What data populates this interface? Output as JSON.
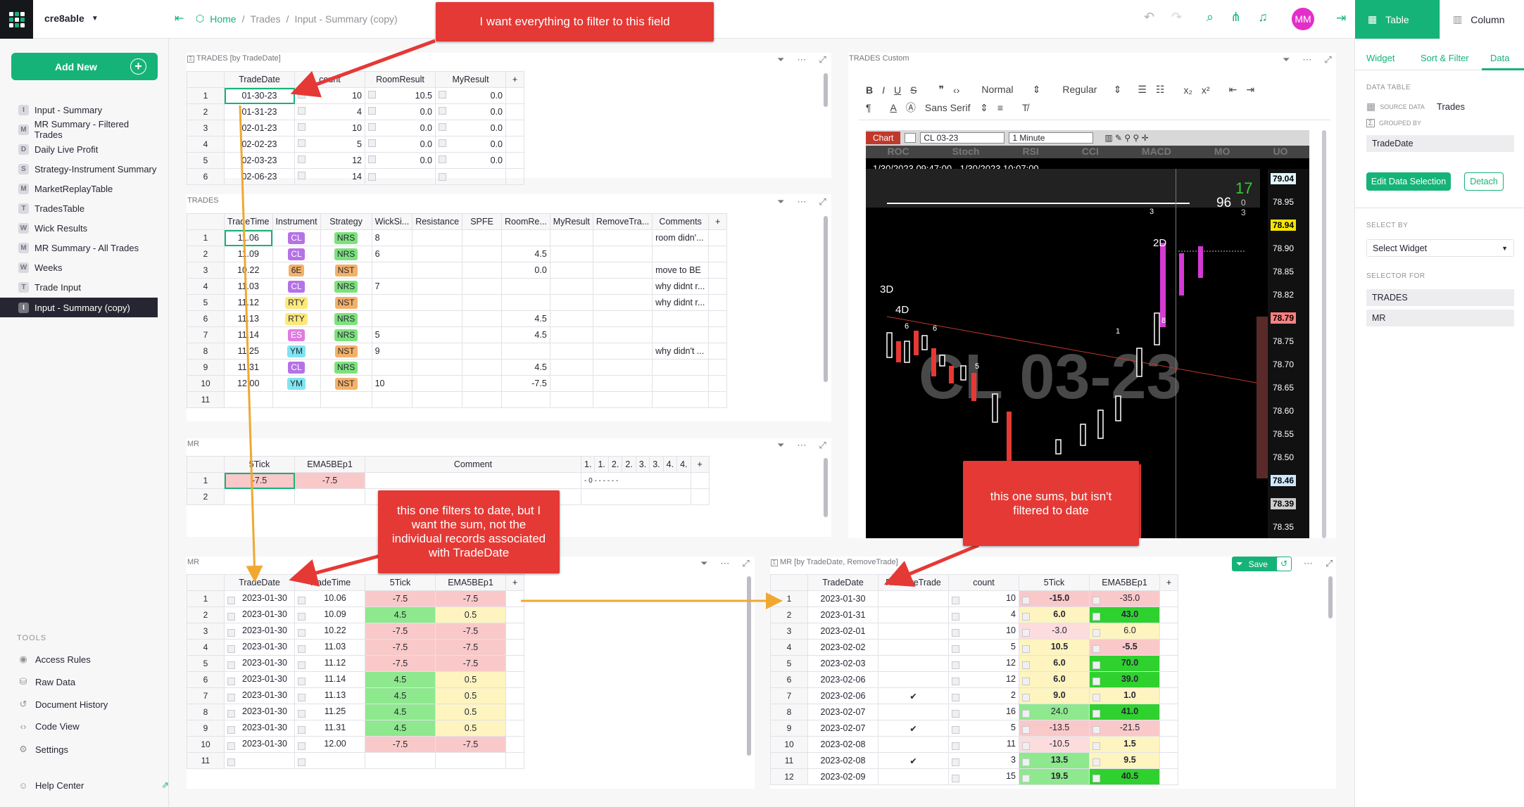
{
  "app": {
    "org": "cre8able"
  },
  "breadcrumb": [
    "Home",
    "Trades",
    "Input - Summary (copy)"
  ],
  "user": {
    "initials": "MM",
    "avatar_color": "#e32fc9"
  },
  "top_tabs": {
    "table": "Table",
    "column": "Column"
  },
  "sidebar": {
    "add_new": "Add New",
    "pages": [
      {
        "icon": "I",
        "label": "Input - Summary"
      },
      {
        "icon": "M",
        "label": "MR Summary - Filtered Trades"
      },
      {
        "icon": "D",
        "label": "Daily Live Profit"
      },
      {
        "icon": "S",
        "label": "Strategy-Instrument Summary"
      },
      {
        "icon": "M",
        "label": "MarketReplayTable"
      },
      {
        "icon": "T",
        "label": "TradesTable"
      },
      {
        "icon": "W",
        "label": "Wick Results"
      },
      {
        "icon": "M",
        "label": "MR Summary - All Trades"
      },
      {
        "icon": "W",
        "label": "Weeks"
      },
      {
        "icon": "T",
        "label": "Trade Input"
      },
      {
        "icon": "I",
        "label": "Input - Summary (copy)"
      }
    ],
    "tools_label": "TOOLS",
    "tools": [
      "Access Rules",
      "Raw Data",
      "Document History",
      "Code View",
      "Settings"
    ],
    "help": "Help Center"
  },
  "widgets": {
    "trades_by_date": {
      "title": "TRADES [by TradeDate]",
      "columns": [
        "TradeDate",
        "count",
        "RoomResult",
        "MyResult",
        "+"
      ],
      "rows": [
        {
          "n": "1",
          "date": "01-30-23",
          "count": "10",
          "room": "10.5",
          "my": "0.0"
        },
        {
          "n": "2",
          "date": "01-31-23",
          "count": "4",
          "room": "0.0",
          "my": "0.0"
        },
        {
          "n": "3",
          "date": "02-01-23",
          "count": "10",
          "room": "0.0",
          "my": "0.0"
        },
        {
          "n": "4",
          "date": "02-02-23",
          "count": "5",
          "room": "0.0",
          "my": "0.0"
        },
        {
          "n": "5",
          "date": "02-03-23",
          "count": "12",
          "room": "0.0",
          "my": "0.0"
        },
        {
          "n": "6",
          "date": "02-06-23",
          "count": "14",
          "room": "",
          "my": ""
        }
      ]
    },
    "trades": {
      "title": "TRADES",
      "columns": [
        "TradeTime",
        "Instrument",
        "Strategy",
        "WickSi...",
        "Resistance",
        "SPFE",
        "RoomRe...",
        "MyResult",
        "RemoveTra...",
        "Comments",
        "+"
      ],
      "rows": [
        {
          "n": "1",
          "time": "11.06",
          "inst": "CL",
          "strat": "NRS",
          "wick": "8",
          "room": "",
          "comment": "room didn'..."
        },
        {
          "n": "2",
          "time": "11.09",
          "inst": "CL",
          "strat": "NRS",
          "wick": "6",
          "room": "4.5",
          "comment": ""
        },
        {
          "n": "3",
          "time": "10.22",
          "inst": "6E",
          "strat": "NST",
          "wick": "",
          "room": "0.0",
          "comment": "move to BE"
        },
        {
          "n": "4",
          "time": "11.03",
          "inst": "CL",
          "strat": "NRS",
          "wick": "7",
          "room": "",
          "comment": "why didnt r..."
        },
        {
          "n": "5",
          "time": "11.12",
          "inst": "RTY",
          "strat": "NST",
          "wick": "",
          "room": "",
          "comment": "why didnt r..."
        },
        {
          "n": "6",
          "time": "11.13",
          "inst": "RTY",
          "strat": "NRS",
          "wick": "",
          "room": "4.5",
          "comment": ""
        },
        {
          "n": "7",
          "time": "11.14",
          "inst": "ES",
          "strat": "NRS",
          "wick": "5",
          "room": "4.5",
          "comment": ""
        },
        {
          "n": "8",
          "time": "11.25",
          "inst": "YM",
          "strat": "NST",
          "wick": "9",
          "room": "",
          "comment": "why didn't ..."
        },
        {
          "n": "9",
          "time": "11.31",
          "inst": "CL",
          "strat": "NRS",
          "wick": "",
          "room": "4.5",
          "comment": ""
        },
        {
          "n": "10",
          "time": "12.00",
          "inst": "YM",
          "strat": "NST",
          "wick": "10",
          "room": "-7.5",
          "comment": ""
        },
        {
          "n": "11",
          "time": "",
          "inst": "",
          "strat": "",
          "wick": "",
          "room": "",
          "comment": ""
        }
      ]
    },
    "mr_small": {
      "title": "MR",
      "columns": [
        "5Tick",
        "EMA5BEp1",
        "Comment",
        "1.",
        "1.",
        "2.",
        "2.",
        "3.",
        "3.",
        "4.",
        "4.",
        "+"
      ],
      "rows": [
        {
          "n": "1",
          "tick": "-7.5",
          "ema": "-7.5",
          "comment": "",
          "extra": "- 0 - - - - - -"
        },
        {
          "n": "2",
          "tick": "",
          "ema": "",
          "comment": "",
          "extra": ""
        }
      ]
    },
    "mr_bottom": {
      "title": "MR",
      "columns": [
        "TradeDate",
        "TradeTime",
        "5Tick",
        "EMA5BEp1",
        "+"
      ],
      "rows": [
        {
          "n": "1",
          "date": "2023-01-30",
          "time": "10.06",
          "tick": "-7.5",
          "ema": "-7.5"
        },
        {
          "n": "2",
          "date": "2023-01-30",
          "time": "10.09",
          "tick": "4.5",
          "ema": "0.5"
        },
        {
          "n": "3",
          "date": "2023-01-30",
          "time": "10.22",
          "tick": "-7.5",
          "ema": "-7.5"
        },
        {
          "n": "4",
          "date": "2023-01-30",
          "time": "11.03",
          "tick": "-7.5",
          "ema": "-7.5"
        },
        {
          "n": "5",
          "date": "2023-01-30",
          "time": "11.12",
          "tick": "-7.5",
          "ema": "-7.5"
        },
        {
          "n": "6",
          "date": "2023-01-30",
          "time": "11.14",
          "tick": "4.5",
          "ema": "0.5"
        },
        {
          "n": "7",
          "date": "2023-01-30",
          "time": "11.13",
          "tick": "4.5",
          "ema": "0.5"
        },
        {
          "n": "8",
          "date": "2023-01-30",
          "time": "11.25",
          "tick": "4.5",
          "ema": "0.5"
        },
        {
          "n": "9",
          "date": "2023-01-30",
          "time": "11.31",
          "tick": "4.5",
          "ema": "0.5"
        },
        {
          "n": "10",
          "date": "2023-01-30",
          "time": "12.00",
          "tick": "-7.5",
          "ema": "-7.5"
        },
        {
          "n": "11",
          "date": "",
          "time": "",
          "tick": "",
          "ema": ""
        }
      ]
    },
    "mr_by_date": {
      "title": "MR [by TradeDate, RemoveTrade]",
      "save": "Save",
      "columns": [
        "TradeDate",
        "RemoveTrade",
        "count",
        "5Tick",
        "EMA5BEp1",
        "+"
      ],
      "rows": [
        {
          "n": "1",
          "date": "2023-01-30",
          "rm": "",
          "count": "10",
          "tick": "-15.0",
          "ema": "-35.0"
        },
        {
          "n": "2",
          "date": "2023-01-31",
          "rm": "",
          "count": "4",
          "tick": "6.0",
          "ema": "43.0"
        },
        {
          "n": "3",
          "date": "2023-02-01",
          "rm": "",
          "count": "10",
          "tick": "-3.0",
          "ema": "6.0"
        },
        {
          "n": "4",
          "date": "2023-02-02",
          "rm": "",
          "count": "5",
          "tick": "10.5",
          "ema": "-5.5"
        },
        {
          "n": "5",
          "date": "2023-02-03",
          "rm": "",
          "count": "12",
          "tick": "6.0",
          "ema": "70.0"
        },
        {
          "n": "6",
          "date": "2023-02-06",
          "rm": "",
          "count": "12",
          "tick": "6.0",
          "ema": "39.0"
        },
        {
          "n": "7",
          "date": "2023-02-06",
          "rm": "✔",
          "count": "2",
          "tick": "9.0",
          "ema": "1.0"
        },
        {
          "n": "8",
          "date": "2023-02-07",
          "rm": "",
          "count": "16",
          "tick": "24.0",
          "ema": "41.0"
        },
        {
          "n": "9",
          "date": "2023-02-07",
          "rm": "✔",
          "count": "5",
          "tick": "-13.5",
          "ema": "-21.5"
        },
        {
          "n": "10",
          "date": "2023-02-08",
          "rm": "",
          "count": "11",
          "tick": "-10.5",
          "ema": "1.5"
        },
        {
          "n": "11",
          "date": "2023-02-08",
          "rm": "✔",
          "count": "3",
          "tick": "13.5",
          "ema": "9.5"
        },
        {
          "n": "12",
          "date": "2023-02-09",
          "rm": "",
          "count": "15",
          "tick": "19.5",
          "ema": "40.5"
        }
      ]
    },
    "custom": {
      "title": "TRADES Custom",
      "toolbar": {
        "style": "Normal",
        "weight": "Regular",
        "font": "Sans Serif"
      },
      "chart": {
        "tab": "Chart",
        "symbol": "CL 03-23",
        "interval": "1 Minute",
        "indicators": [
          "ROC",
          "Stoch",
          "RSI",
          "CCI",
          "MACD",
          "MO",
          "UO"
        ],
        "range": "1/30/2023 09:47:00 - 1/30/2023 10:07:00",
        "counter": "17",
        "counter2": "0",
        "counter3": "3",
        "reading": "96",
        "watermark": "CL 03-23",
        "prices": [
          "79.04",
          "78.95",
          "78.94",
          "78.90",
          "78.85",
          "78.82",
          "78.79",
          "78.75",
          "78.70",
          "78.65",
          "78.60",
          "78.55",
          "78.50",
          "78.46",
          "78.39",
          "78.35"
        ],
        "labels": [
          "3D",
          "4D",
          "2D",
          "3",
          "1",
          "8",
          "6",
          "6",
          "5"
        ]
      }
    }
  },
  "callouts": {
    "top": "I want everything to filter to this field",
    "left": "this one filters to date, but I want the sum, not the individual records associated with TradeDate",
    "right": "this one sums, but isn't filtered to date"
  },
  "right_panel": {
    "tabs": [
      "Widget",
      "Sort & Filter",
      "Data"
    ],
    "data_table_label": "DATA TABLE",
    "source_data_label": "SOURCE DATA",
    "source_data_value": "Trades",
    "grouped_by_label": "GROUPED BY",
    "grouped_by_value": "TradeDate",
    "edit_button": "Edit Data Selection",
    "detach_button": "Detach",
    "select_by_label": "SELECT BY",
    "select_widget": "Select Widget",
    "selector_for_label": "SELECTOR FOR",
    "selectors": [
      "TRADES",
      "MR"
    ]
  }
}
